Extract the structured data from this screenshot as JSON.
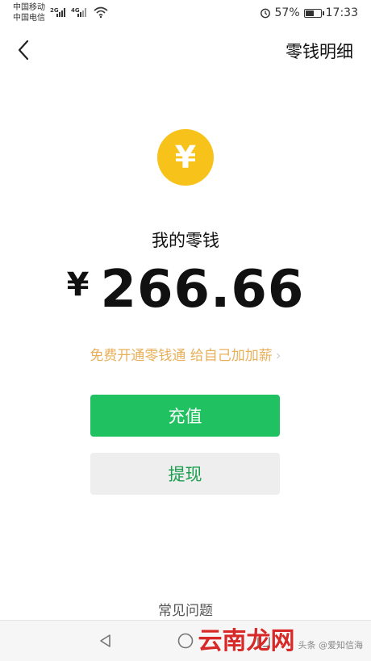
{
  "status_bar": {
    "carrier_1": "中国移动",
    "carrier_2": "中国电信",
    "net_1": "2G",
    "net_2": "4G",
    "battery_percent": "57%",
    "battery_level": 0.57,
    "time": "17:33"
  },
  "header": {
    "title": "零钱明细"
  },
  "wallet": {
    "coin_symbol": "¥",
    "label": "我的零钱",
    "currency": "¥",
    "amount": "266.66"
  },
  "promo": {
    "text": "免费开通零钱通 给自己加加薪",
    "chevron": "›"
  },
  "actions": {
    "recharge_label": "充值",
    "withdraw_label": "提现"
  },
  "footer": {
    "faq_label": "常见问题"
  },
  "watermark": {
    "logo_text": "云南龙网",
    "credit_text": "头条 @爱知信海"
  },
  "colors": {
    "coin": "#f7c21a",
    "primary_green": "#1fc160",
    "promo_text": "#e8b05a",
    "withdraw_bg": "#eeeeee"
  }
}
